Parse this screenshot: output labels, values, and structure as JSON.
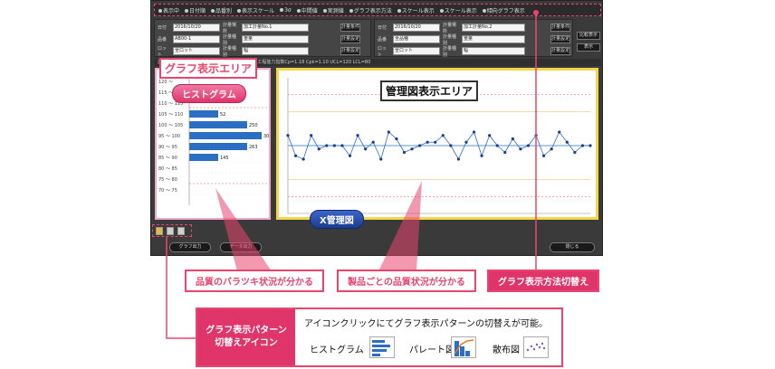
{
  "toolbar": {
    "options": [
      "表示中",
      "日付順",
      "品番別",
      "表示スケール",
      "3σ",
      "中間値",
      "実測値",
      "グラフ表示方法",
      "スケール表示",
      "スケール表示",
      "傾向グラフ表示"
    ]
  },
  "form_left": {
    "date_label": "日付",
    "date_value": "2016/10/20",
    "process_label": "計量場所",
    "process_value": "加工計量No.1",
    "item_label": "品番",
    "item_value": "AB00-1",
    "cond_label": "計量種別",
    "cond_value": "重量",
    "lot_label": "ロット",
    "lot_value": "全ロット",
    "cond2_label": "計量種別",
    "cond2_value": "幅",
    "btn1": "計量条件",
    "btn2": "計量設定",
    "btn3": "計量設定"
  },
  "form_right": {
    "date_label": "日付",
    "date_value": "2016/10/20",
    "process_label": "計量場所",
    "process_value": "加工計量No.2",
    "item_label": "品番",
    "item_value": "全品種",
    "cond_label": "計量種別",
    "cond_value": "重量",
    "lot_label": "ロット",
    "lot_value": "全ロット",
    "cond2_label": "計量種別",
    "cond2_value": "幅",
    "btn1": "計量条件",
    "btn2": "計量設定",
    "btn3": "計量設定",
    "side1": "比較表示",
    "side2": "表示"
  },
  "info_line": "計量日時  2016/10/20 08:02:00   計量値  18mm   工程能力指数Cp=1.18  Cpk=1.10  UCL=120  LCL=80",
  "labels": {
    "graph_area": "グラフ表示エリア",
    "histogram_pill": "ヒストグラム",
    "control_area": "管理図表示エリア",
    "x_chart_pill": "X管理図",
    "callout_variation": "品質のバラツキ状況が分かる",
    "callout_product": "製品ごとの品質状況が分かる",
    "callout_switch": "グラフ表示方法切替え"
  },
  "legend": {
    "title_line1": "グラフ表示パターン",
    "title_line2": "切替えアイコン",
    "text": "アイコンクリックにてグラフ表示パターンの切替えが可能。",
    "item1": "ヒストグラム",
    "item2": "パレート図",
    "item3": "散布図"
  },
  "bottom_buttons": {
    "left1": "グラフ出力",
    "left2": "データ出力",
    "right": "閉じる"
  },
  "colors": {
    "accent_pink": "#e0356a",
    "highlight_yellow": "#f5d64a",
    "bar_blue": "#2a6fc4"
  },
  "histogram": {
    "bins": [
      "120 〜",
      "115 〜 120",
      "110 〜 115",
      "105 〜 110",
      "100 〜 105",
      "95 〜 100",
      "90 〜 95",
      "85 〜 90",
      "80 〜 85",
      "75 〜 80",
      "70 〜 75"
    ],
    "counts": [
      0,
      0,
      0,
      2,
      4,
      5,
      4,
      2,
      0,
      0,
      0
    ],
    "count_labels": [
      "",
      "",
      "",
      "52",
      "250",
      "305",
      "263",
      "145",
      "",
      "",
      ""
    ]
  },
  "control_chart": {
    "points": [
      103,
      97,
      96,
      103,
      99,
      100,
      100,
      100,
      97,
      103,
      99,
      101,
      96,
      104,
      102,
      98,
      99,
      100,
      101,
      101,
      103,
      100,
      96,
      101,
      104,
      97,
      103,
      100,
      98,
      102,
      99,
      100,
      103,
      97,
      99,
      104,
      101,
      98,
      100,
      100
    ],
    "ucl": 110,
    "lcl": 90,
    "center": 100
  }
}
